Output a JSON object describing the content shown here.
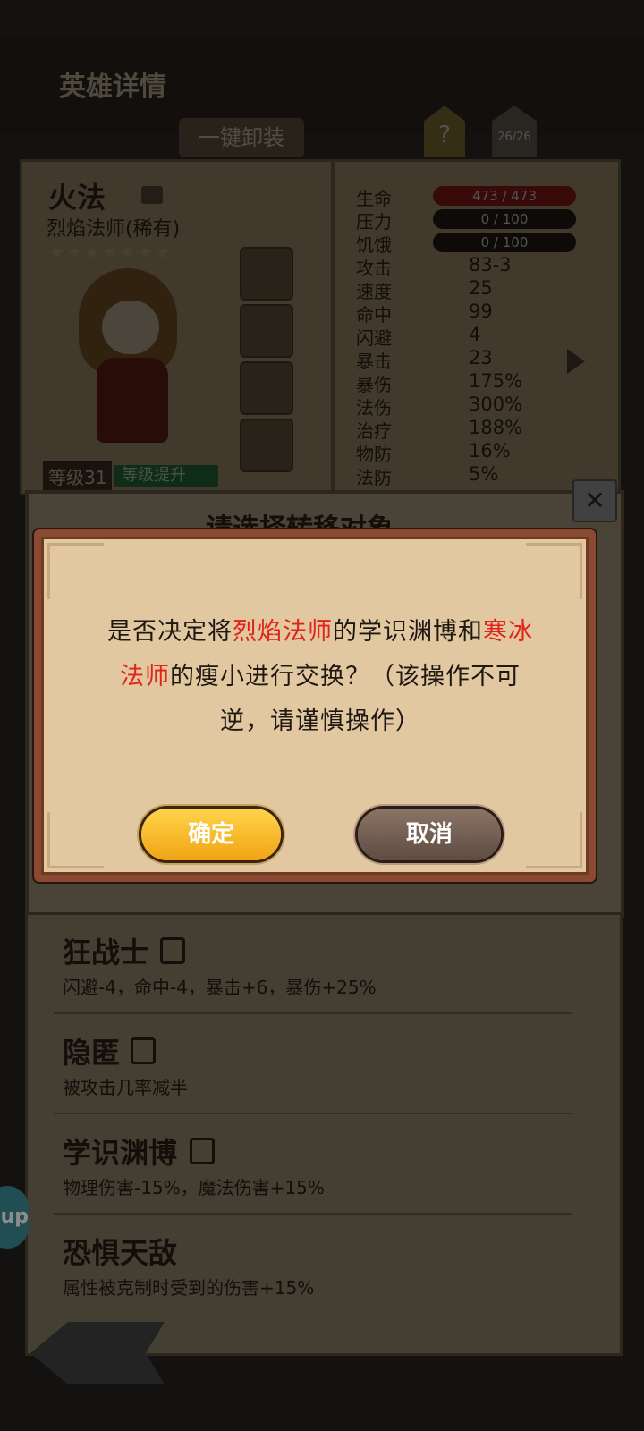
{
  "header": {
    "title": "英雄详情",
    "unequip_label": "一键卸装",
    "help_label": "?",
    "count_label": "26/26"
  },
  "hero": {
    "name": "火法",
    "class_label": "烈焰法师(稀有)",
    "stars": "★★★★★★★",
    "level_label": "等级31",
    "promote_label": "等级提升"
  },
  "stats": [
    {
      "label": "生命",
      "value": "473 / 473",
      "kind": "bar-hp"
    },
    {
      "label": "压力",
      "value": "0 / 100",
      "kind": "bar"
    },
    {
      "label": "饥饿",
      "value": "0 / 100",
      "kind": "bar"
    },
    {
      "label": "攻击",
      "value": "83-3"
    },
    {
      "label": "速度",
      "value": "25"
    },
    {
      "label": "命中",
      "value": "99"
    },
    {
      "label": "闪避",
      "value": "4"
    },
    {
      "label": "暴击",
      "value": "23"
    },
    {
      "label": "暴伤",
      "value": "175%"
    },
    {
      "label": "法伤",
      "value": "300%"
    },
    {
      "label": "治疗",
      "value": "188%"
    },
    {
      "label": "物防",
      "value": "16%"
    },
    {
      "label": "法防",
      "value": "5%"
    }
  ],
  "select_title": "请选择转移对象",
  "traits": [
    {
      "name": "狂战士",
      "desc": "闪避-4，命中-4，暴击+6，暴伤+25%"
    },
    {
      "name": "隐匿",
      "desc": "被攻击几率减半"
    },
    {
      "name": "学识渊博",
      "desc": "物理伤害-15%，魔法伤害+15%"
    },
    {
      "name": "恐惧天敌",
      "desc": "属性被克制时受到的伤害+15%"
    }
  ],
  "float_button_label": "up",
  "dialog": {
    "part1": "是否决定将",
    "hero_a": "烈焰法师",
    "part2": "的学识渊博和",
    "hero_b": "寒冰法师",
    "part3": "的瘦小进行交换？（该操作不可逆，请谨慎操作）",
    "confirm_label": "确定",
    "cancel_label": "取消"
  },
  "colors": {
    "highlight": "#e2231a",
    "confirm": "#f0a414",
    "cancel": "#6e5a4e"
  }
}
